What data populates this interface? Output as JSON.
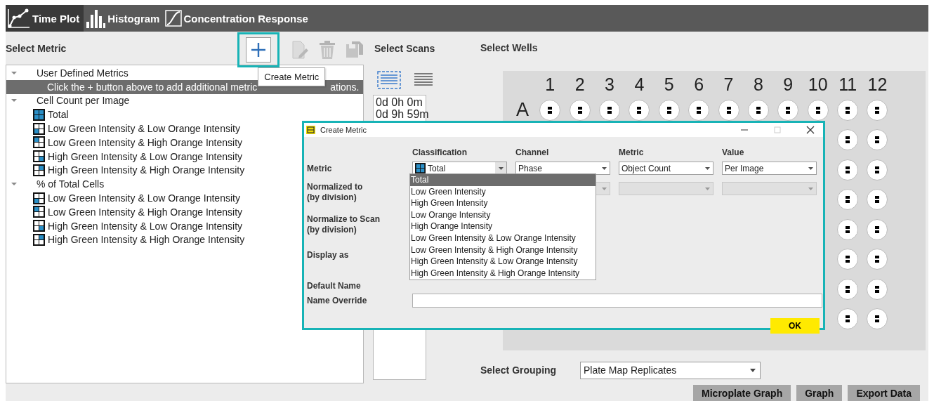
{
  "tabs": [
    {
      "label": "Time Plot",
      "kind": "timeplot",
      "selected": true
    },
    {
      "label": "Histogram",
      "kind": "histogram",
      "selected": false
    },
    {
      "label": "Concentration Response",
      "kind": "concentration",
      "selected": false
    }
  ],
  "metric_panel": {
    "title": "Select Metric",
    "tooltip": "Create Metric",
    "tree": [
      {
        "label": "User Defined Metrics",
        "expanded": true,
        "children": [
          {
            "kind": "hint",
            "texts": [
              "Click the + button above to add additional metric",
              "ations."
            ],
            "selected": true
          }
        ]
      },
      {
        "label": "Cell Count per Image",
        "expanded": true,
        "children": [
          {
            "kind": "total",
            "label": "Total",
            "selected": false
          },
          {
            "kind": "bottomleft",
            "label": "Low Green Intensity & Low Orange Intensity",
            "selected": false
          },
          {
            "kind": "topleft",
            "label": "Low Green Intensity & High Orange Intensity",
            "selected": false
          },
          {
            "kind": "bottomright",
            "label": "High Green Intensity & Low Orange Intensity",
            "selected": false
          },
          {
            "kind": "topright",
            "label": "High Green Intensity & High Orange Intensity",
            "selected": false
          }
        ]
      },
      {
        "label": "% of Total Cells",
        "expanded": true,
        "children": [
          {
            "kind": "bottomleft",
            "label": "Low Green Intensity & Low Orange Intensity",
            "selected": false
          },
          {
            "kind": "topleft",
            "label": "Low Green Intensity & High Orange Intensity",
            "selected": false
          },
          {
            "kind": "bottomright",
            "label": "High Green Intensity & Low Orange Intensity",
            "selected": false
          },
          {
            "kind": "topright",
            "label": "High Green Intensity & High Orange Intensity",
            "selected": false
          }
        ]
      }
    ]
  },
  "scans_panel": {
    "title": "Select Scans",
    "scans": [
      "0d 0h 0m",
      "0d 9h 59m"
    ]
  },
  "wells_panel": {
    "title": "Select Wells",
    "columns": [
      "1",
      "2",
      "3",
      "4",
      "5",
      "6",
      "7",
      "8",
      "9",
      "10",
      "11",
      "12"
    ],
    "rows": [
      {
        "label": "A"
      }
    ],
    "grouping_label": "Select Grouping",
    "grouping_value": "Plate Map Replicates"
  },
  "actions": [
    "Microplate Graph",
    "Graph",
    "Export Data"
  ],
  "dialog": {
    "title": "Create Metric",
    "headers": [
      "Classification",
      "Channel",
      "Metric",
      "Value"
    ],
    "labels": [
      {
        "text": "Metric"
      },
      {
        "text": "Normalized to",
        "sub": "(by division)"
      },
      {
        "text": "Normalize to Scan",
        "sub": "(by division)"
      },
      {
        "text": "Display as"
      },
      {
        "text": "Default Name"
      },
      {
        "text": "Name Override"
      }
    ],
    "metric_combos": [
      {
        "value": "Total",
        "disabled": false
      },
      {
        "value": "Phase",
        "disabled": false
      },
      {
        "value": "Object Count",
        "disabled": false
      },
      {
        "value": "Per Image",
        "disabled": false
      }
    ],
    "normalize_combos": [
      {
        "disabled": true
      },
      {
        "disabled": true
      },
      {
        "disabled": true
      }
    ],
    "options": [
      {
        "label": "Total",
        "selected": true
      },
      {
        "label": "Low Green Intensity",
        "selected": false
      },
      {
        "label": "High Green Intensity",
        "selected": false
      },
      {
        "label": "Low Orange Intensity",
        "selected": false
      },
      {
        "label": "High Orange Intensity",
        "selected": false
      },
      {
        "label": "Low Green Intensity & Low Orange Intensity",
        "selected": false
      },
      {
        "label": "Low Green Intensity & High Orange Intensity",
        "selected": false
      },
      {
        "label": "High Green Intensity & Low Orange Intensity",
        "selected": false
      },
      {
        "label": "High Green Intensity & High Orange Intensity",
        "selected": false
      }
    ],
    "ok": "OK"
  }
}
